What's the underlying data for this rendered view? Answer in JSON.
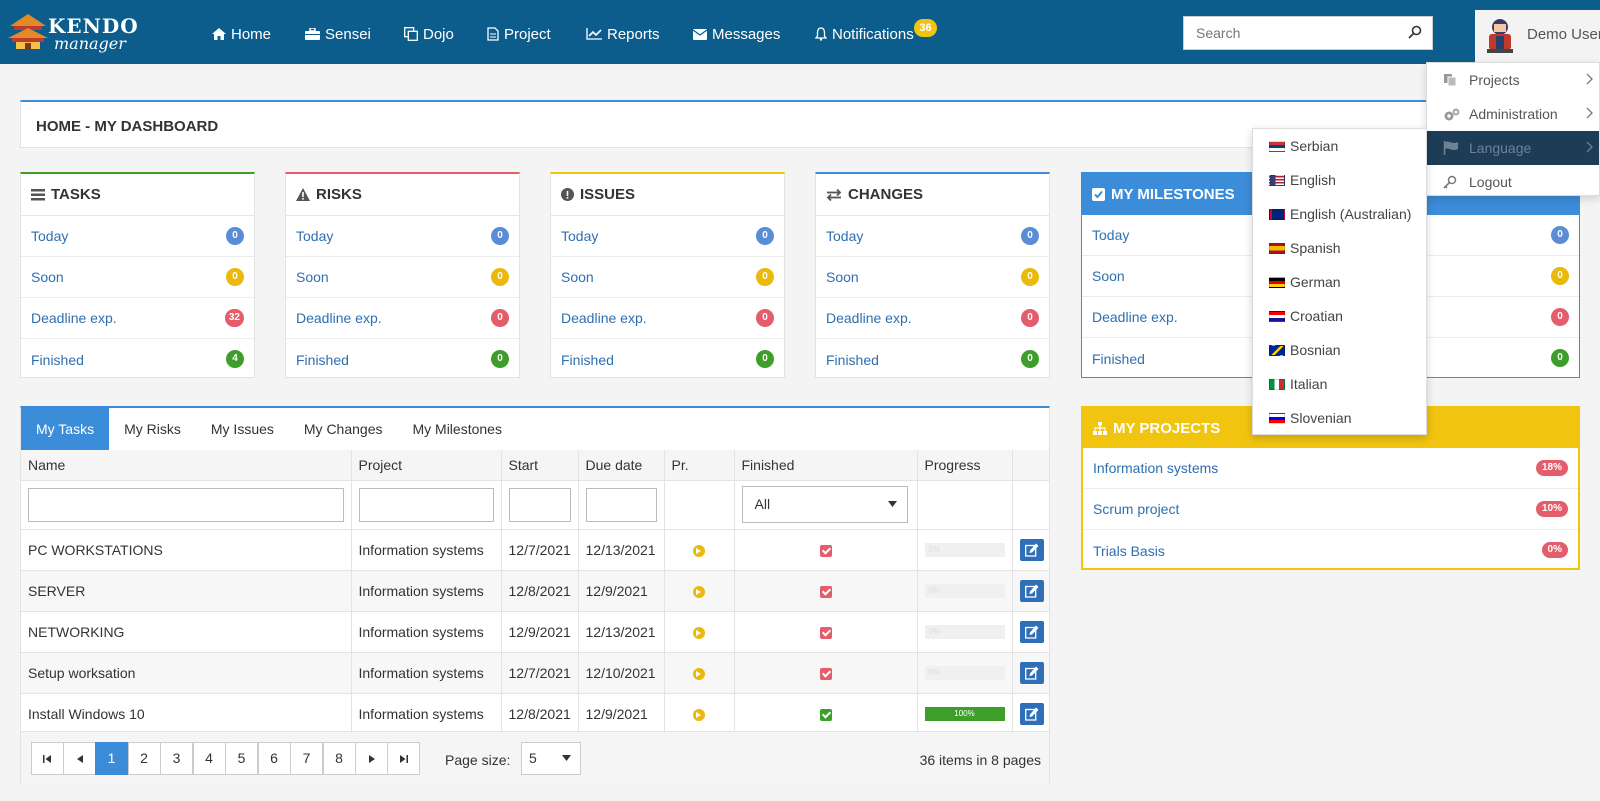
{
  "brand": {
    "line1": "KENDO",
    "line2": "manager"
  },
  "nav": {
    "home": "Home",
    "sensei": "Sensei",
    "dojo": "Dojo",
    "project": "Project",
    "reports": "Reports",
    "messages": "Messages",
    "notifications": "Notifications",
    "notifications_count": "36"
  },
  "search": {
    "placeholder": "Search",
    "value": ""
  },
  "user": {
    "name": "Demo User"
  },
  "user_menu": {
    "projects": "Projects",
    "administration": "Administration",
    "language": "Language",
    "logout": "Logout"
  },
  "languages": [
    {
      "label": "Serbian",
      "flag": "rs"
    },
    {
      "label": "English",
      "flag": "us"
    },
    {
      "label": "English (Australian)",
      "flag": "au"
    },
    {
      "label": "Spanish",
      "flag": "es"
    },
    {
      "label": "German",
      "flag": "de"
    },
    {
      "label": "Croatian",
      "flag": "hr"
    },
    {
      "label": "Bosnian",
      "flag": "ba"
    },
    {
      "label": "Italian",
      "flag": "it"
    },
    {
      "label": "Slovenian",
      "flag": "si"
    }
  ],
  "dashboard": {
    "title": "HOME - MY DASHBOARD"
  },
  "cards": {
    "tasks": {
      "title": "TASKS",
      "today": "Today",
      "today_count": "0",
      "soon": "Soon",
      "soon_count": "0",
      "deadline": "Deadline exp.",
      "deadline_count": "32",
      "finished": "Finished",
      "finished_count": "4"
    },
    "risks": {
      "title": "RISKS",
      "today": "Today",
      "today_count": "0",
      "soon": "Soon",
      "soon_count": "0",
      "deadline": "Deadline exp.",
      "deadline_count": "0",
      "finished": "Finished",
      "finished_count": "0"
    },
    "issues": {
      "title": "ISSUES",
      "today": "Today",
      "today_count": "0",
      "soon": "Soon",
      "soon_count": "0",
      "deadline": "Deadline exp.",
      "deadline_count": "0",
      "finished": "Finished",
      "finished_count": "0"
    },
    "changes": {
      "title": "CHANGES",
      "today": "Today",
      "today_count": "0",
      "soon": "Soon",
      "soon_count": "0",
      "deadline": "Deadline exp.",
      "deadline_count": "0",
      "finished": "Finished",
      "finished_count": "0"
    },
    "milestones": {
      "title": "MY MILESTONES",
      "today": "Today",
      "today_count": "0",
      "soon": "Soon",
      "soon_count": "0",
      "deadline": "Deadline exp.",
      "deadline_count": "0",
      "finished": "Finished",
      "finished_count": "0"
    }
  },
  "projects": {
    "title": "MY PROJECTS",
    "items": [
      {
        "name": "Information systems",
        "pct": "18%"
      },
      {
        "name": "Scrum project",
        "pct": "10%"
      },
      {
        "name": "Trials Basis",
        "pct": "0%"
      }
    ]
  },
  "tabs": [
    "My Tasks",
    "My Risks",
    "My Issues",
    "My Changes",
    "My Milestones"
  ],
  "grid": {
    "columns": [
      "Name",
      "Project",
      "Start",
      "Due date",
      "Pr.",
      "Finished",
      "Progress"
    ],
    "finished_filter": "All",
    "rows": [
      {
        "name": "PC WORKSTATIONS",
        "project": "Information systems",
        "start": "12/7/2021",
        "due": "12/13/2021",
        "finished": false,
        "progress": 0,
        "progress_label": "0%"
      },
      {
        "name": "SERVER",
        "project": "Information systems",
        "start": "12/8/2021",
        "due": "12/9/2021",
        "finished": false,
        "progress": 0,
        "progress_label": "0%"
      },
      {
        "name": "NETWORKING",
        "project": "Information systems",
        "start": "12/9/2021",
        "due": "12/13/2021",
        "finished": false,
        "progress": 0,
        "progress_label": "0%"
      },
      {
        "name": "Setup worksation",
        "project": "Information systems",
        "start": "12/7/2021",
        "due": "12/10/2021",
        "finished": false,
        "progress": 0,
        "progress_label": "0%"
      },
      {
        "name": "Install Windows 10",
        "project": "Information systems",
        "start": "12/8/2021",
        "due": "12/9/2021",
        "finished": true,
        "progress": 100,
        "progress_label": "100%"
      }
    ]
  },
  "pager": {
    "pages": [
      "1",
      "2",
      "3",
      "4",
      "5",
      "6",
      "7",
      "8"
    ],
    "current": "1",
    "page_size_label": "Page size:",
    "page_size": "5",
    "info": "36 items in 8 pages"
  }
}
